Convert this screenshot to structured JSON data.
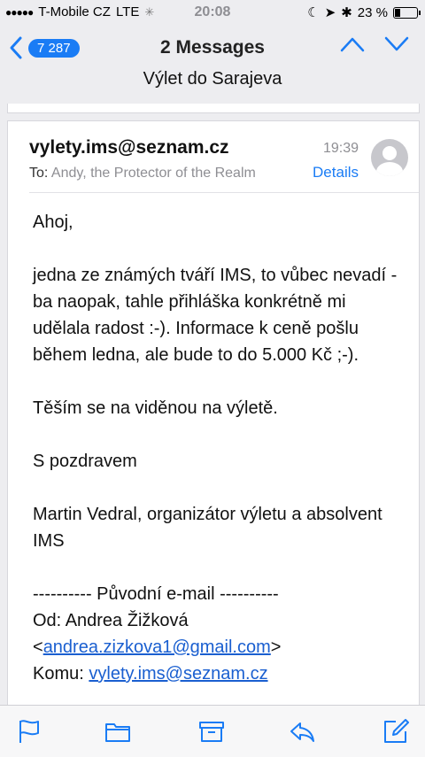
{
  "status_bar": {
    "carrier": "T-Mobile CZ",
    "network": "LTE",
    "time": "20:08",
    "battery": "23 %",
    "battery_level": 0.23
  },
  "nav": {
    "back_badge": "7 287",
    "title": "2 Messages",
    "subject": "Výlet do Sarajeva"
  },
  "message": {
    "from": "vylety.ims@seznam.cz",
    "to_label": "To:",
    "to": "Andy, the Protector of the Realm",
    "time": "19:39",
    "details_label": "Details",
    "greeting": "Ahoj,",
    "paragraph1": "jedna ze známých tváří IMS, to vůbec nevadí - ba naopak, tahle přihláška konkrétně mi udělala radost :-). Informace k ceně pošlu během ledna, ale bude to do 5.000 Kč ;-).",
    "paragraph2": "Těším se na viděnou na výletě.",
    "closing": "S pozdravem",
    "signature": "Martin Vedral, organizátor výletu a absolvent IMS",
    "forward_header": "---------- Původní e-mail ----------",
    "orig_from_label": "Od: Andrea Žižková",
    "orig_from_email": "andrea.zizkova1@gmail.com",
    "orig_to_label": "Komu:",
    "orig_to_email": "vylety.ims@seznam.cz"
  },
  "icons": {
    "toolbar": [
      "flag-icon",
      "folder-icon",
      "archive-icon",
      "reply-icon",
      "compose-icon"
    ],
    "accent": "#1a7cf5"
  }
}
